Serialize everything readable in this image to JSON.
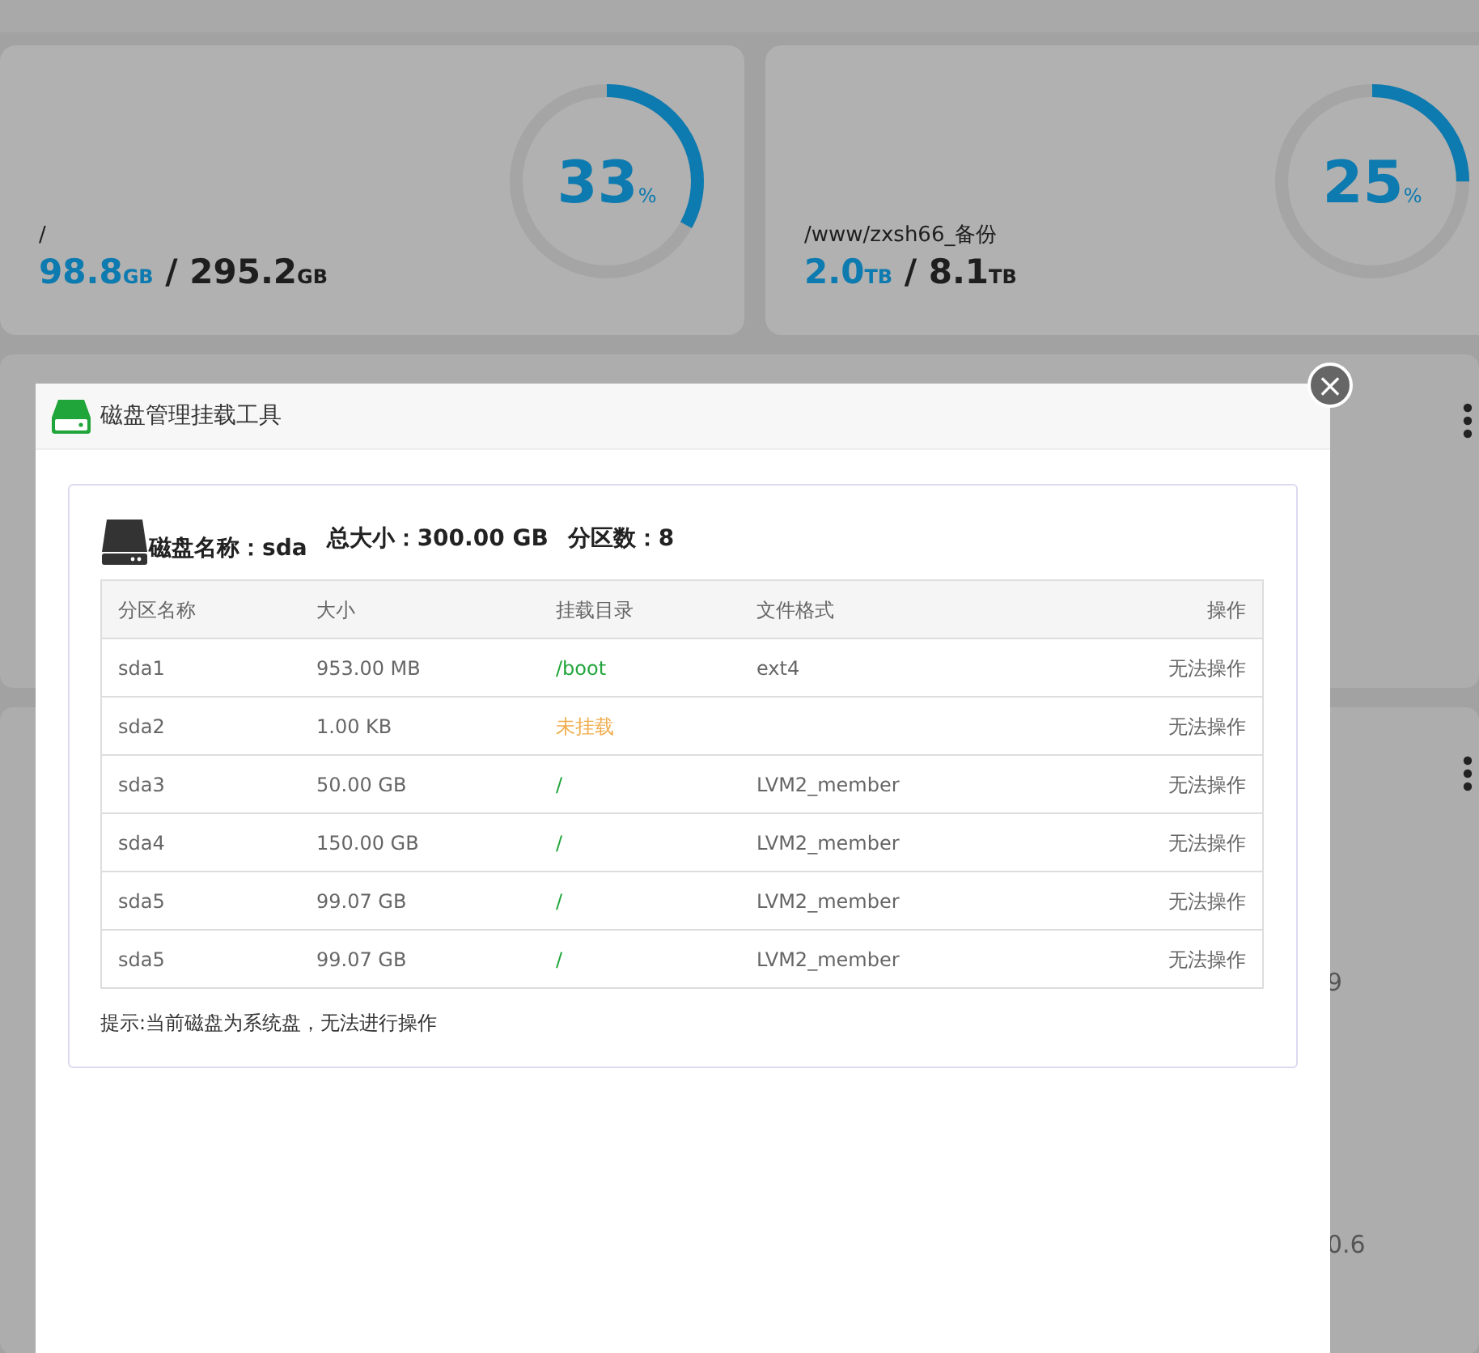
{
  "disk_cards": [
    {
      "path": "/",
      "used": "98.8",
      "used_unit": "GB",
      "separator": "/",
      "total": "295.2",
      "total_unit": "GB",
      "percent": "33",
      "percent_sign": "%",
      "level": 0.33
    },
    {
      "path": "/www/zxsh66_备份",
      "used": "2.0",
      "used_unit": "TB",
      "separator": "/",
      "total": "8.1",
      "total_unit": "TB",
      "percent": "25",
      "percent_sign": "%",
      "level": 0.25
    }
  ],
  "background_fragments": [
    "9",
    "0.6"
  ],
  "dialog": {
    "title": "磁盘管理挂载工具",
    "close": "×",
    "disk_name": "磁盘名称：sda",
    "total_size": "总大小：300.00 GB",
    "partition_count": "分区数：8",
    "table": {
      "columns": [
        "分区名称",
        "大小",
        "挂载目录",
        "文件格式",
        "操作"
      ],
      "rows": [
        {
          "name": "sda1",
          "size": "953.00 MB",
          "mount": "/boot",
          "kind": "mounted",
          "fs": "ext4",
          "action": "无法操作"
        },
        {
          "name": "sda2",
          "size": "1.00 KB",
          "mount": "未挂载",
          "kind": "unmounted",
          "action": "无法操作"
        },
        {
          "name": "sda3",
          "size": "50.00 GB",
          "mount": "/",
          "kind": "mounted",
          "fs": "LVM2_member",
          "action": "无法操作"
        },
        {
          "name": "sda4",
          "size": "150.00 GB",
          "mount": "/",
          "kind": "mounted",
          "fs": "LVM2_member",
          "action": "无法操作"
        },
        {
          "name": "sda5",
          "size": "99.07 GB",
          "mount": "/",
          "kind": "mounted",
          "fs": "LVM2_member",
          "action": "无法操作"
        },
        {
          "name": "sda5",
          "size": "99.07 GB",
          "mount": "/",
          "kind": "mounted",
          "fs": "LVM2_member",
          "action": "无法操作"
        }
      ]
    },
    "hint": "提示:当前磁盘为系统盘，无法进行操作"
  }
}
